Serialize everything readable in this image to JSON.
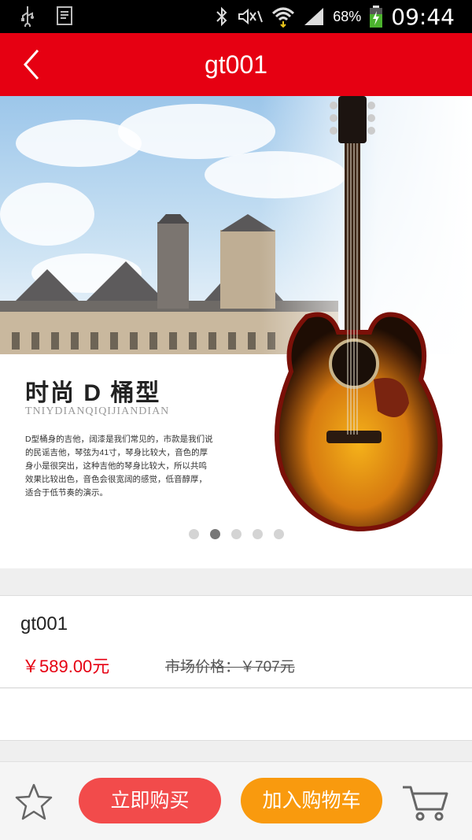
{
  "status_bar": {
    "battery": "68%",
    "time": "09:44"
  },
  "header": {
    "title": "gt001"
  },
  "banner": {
    "headline": "时尚 D 桶型",
    "subline": "TNIYDIANQIQIJIANDIAN",
    "description": "D型桶身的吉他，阔漆是我们常见的，市款是我们说的民谣吉他，琴弦为41寸，琴身比较大，音色的厚身小是很突出，这种吉他的琴身比较大，所以共鸣效果比较出色，音色会很宽阔的感觉，低音醇厚，适合于低节奏的演示。",
    "slide_count": 5,
    "active_slide": 2
  },
  "product": {
    "name": "gt001",
    "price": "￥589.00元",
    "market_price": "市场价格：￥707元"
  },
  "bottom_bar": {
    "buy_label": "立即购买",
    "add_cart_label": "加入购物车"
  },
  "colors": {
    "brand_red": "#e60012",
    "buy_button": "#f24b4b",
    "cart_button": "#f99a0e"
  },
  "icons": [
    "usb-icon",
    "doc-icon",
    "bluetooth-icon",
    "mute-icon",
    "wifi-icon",
    "signal-icon",
    "battery-icon",
    "back-icon",
    "star-icon",
    "cart-icon"
  ]
}
